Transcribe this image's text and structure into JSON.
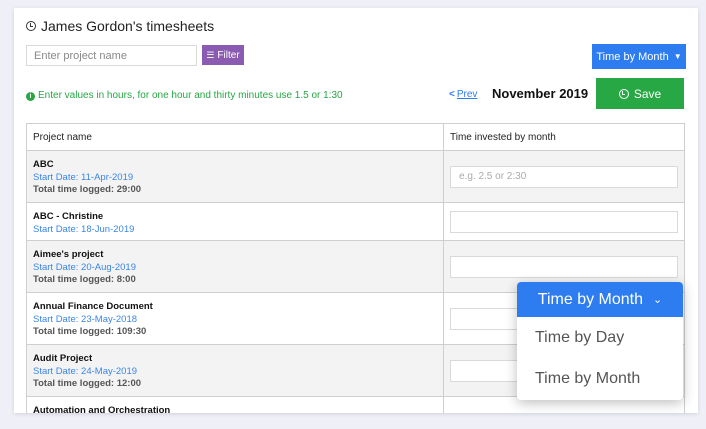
{
  "title": "James Gordon's timesheets",
  "search": {
    "placeholder": "Enter project name"
  },
  "filter_label": "Filter",
  "mode_button": "Time by Month",
  "hint": "Enter values in hours, for one hour and thirty minutes use 1.5 or 1:30",
  "prev_label": "Prev",
  "month": "November 2019",
  "save_label": "Save",
  "table": {
    "col_project": "Project name",
    "col_time": "Time invested by month",
    "input_placeholder": "e.g. 2.5 or 2:30",
    "rows": [
      {
        "name": "ABC",
        "start": "Start Date: 11-Apr-2019",
        "logged": "Total time logged: 29:00"
      },
      {
        "name": "ABC - Christine",
        "start": "Start Date: 18-Jun-2019",
        "logged": ""
      },
      {
        "name": "Aimee's project",
        "start": "Start Date: 20-Aug-2019",
        "logged": "Total time logged: 8:00"
      },
      {
        "name": "Annual Finance Document",
        "start": "Start Date: 23-May-2018",
        "logged": "Total time logged: 109:30"
      },
      {
        "name": "Audit Project",
        "start": "Start Date: 24-May-2019",
        "logged": "Total time logged: 12:00"
      },
      {
        "name": "Automation and Orchestration",
        "start": "",
        "logged": ""
      }
    ]
  },
  "dropdown": {
    "selected": "Time by Month",
    "options": [
      "Time by Day",
      "Time by Month"
    ]
  },
  "colors": {
    "accent": "#2d7cf0",
    "save": "#27a844",
    "filter": "#8a5bb1",
    "hint": "#27a644"
  },
  "icons": {
    "title": "clock-icon",
    "filter": "sliders-icon",
    "hint": "info-icon",
    "save": "clock-icon",
    "dropdown": "chevron-down-icon",
    "prev": "chevron-left-icon"
  }
}
